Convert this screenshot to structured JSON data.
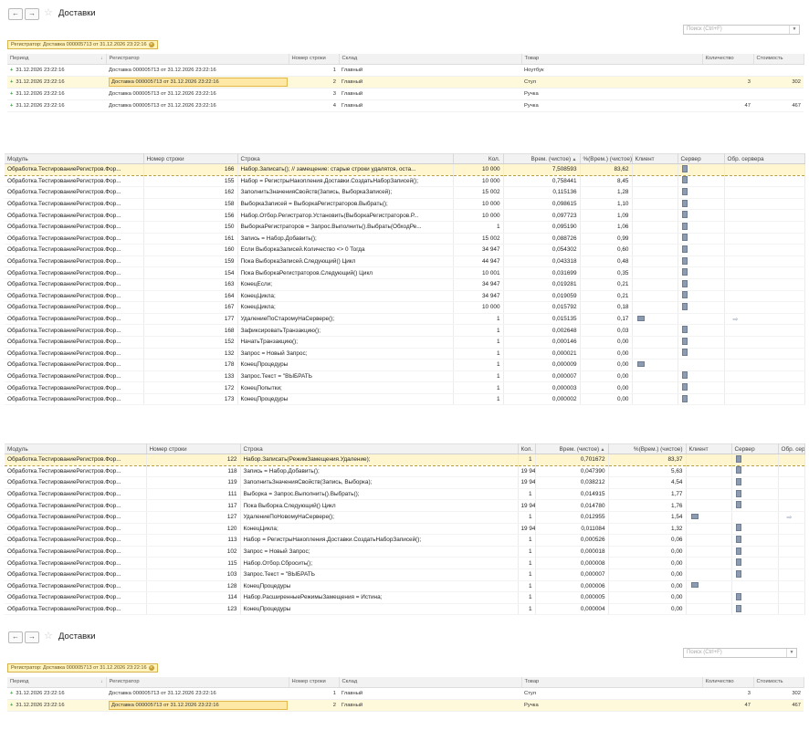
{
  "window1": {
    "title": "Доставки",
    "search_placeholder": "Поиск (Ctrl+F)",
    "registrar_badge": "Регистратор: Доставка 000005713 от 31.12.2026 23:22:16",
    "columns": [
      "Период",
      "Регистратор",
      "Номер строки",
      "Склад",
      "Товар",
      "Количество",
      "Стоимость"
    ],
    "rows": [
      {
        "period": "31.12.2026 23:22:16",
        "registrar": "Доставка 000005713 от 31.12.2026 23:22:16",
        "line": "1",
        "warehouse": "Главный",
        "product": "Ноутбук",
        "qty": "",
        "cost": ""
      },
      {
        "period": "31.12.2026 23:22:16",
        "registrar": "Доставка 000005713 от 31.12.2026 23:22:16",
        "line": "2",
        "warehouse": "Главный",
        "product": "Стул",
        "qty": "3",
        "cost": "302"
      },
      {
        "period": "31.12.2026 23:22:16",
        "registrar": "Доставка 000005713 от 31.12.2026 23:22:16",
        "line": "3",
        "warehouse": "Главный",
        "product": "Ручка",
        "qty": "",
        "cost": ""
      },
      {
        "period": "31.12.2026 23:22:16",
        "registrar": "Доставка 000005713 от 31.12.2026 23:22:16",
        "line": "4",
        "warehouse": "Главный",
        "product": "Ручка",
        "qty": "47",
        "cost": "467"
      }
    ]
  },
  "perf1": {
    "columns": [
      "Модуль",
      "Номер строки",
      "Строка",
      "Кол.",
      "Врем. (чистое)",
      "%(Врем.) (чистое)",
      "Клиент",
      "Сервер",
      "Обр. сервера"
    ],
    "rows": [
      {
        "module": "Обработка.ТестированиеРегистров.Фор...",
        "line": "166",
        "code": "Набор.Записать(); // замещение: старые строки удалятся, оста...",
        "count": "10 000",
        "time": "7,508593",
        "pct": "83,62",
        "client": false,
        "server": true,
        "srv_call": false
      },
      {
        "module": "Обработка.ТестированиеРегистров.Фор...",
        "line": "155",
        "code": "Набор = РегистрыНакопления.Доставки.СоздатьНаборЗаписей();",
        "count": "10 000",
        "time": "0,758441",
        "pct": "8,45",
        "client": false,
        "server": true,
        "srv_call": false
      },
      {
        "module": "Обработка.ТестированиеРегистров.Фор...",
        "line": "162",
        "code": "ЗаполнитьЗначенияСвойств(Запись, ВыборкаЗаписей);",
        "count": "15 002",
        "time": "0,115136",
        "pct": "1,28",
        "client": false,
        "server": true,
        "srv_call": false
      },
      {
        "module": "Обработка.ТестированиеРегистров.Фор...",
        "line": "158",
        "code": "ВыборкаЗаписей = ВыборкаРегистраторов.Выбрать();",
        "count": "10 000",
        "time": "0,098615",
        "pct": "1,10",
        "client": false,
        "server": true,
        "srv_call": false
      },
      {
        "module": "Обработка.ТестированиеРегистров.Фор...",
        "line": "156",
        "code": "Набор.Отбор.Регистратор.Установить(ВыборкаРегистраторов.Р...",
        "count": "10 000",
        "time": "0,097723",
        "pct": "1,09",
        "client": false,
        "server": true,
        "srv_call": false
      },
      {
        "module": "Обработка.ТестированиеРегистров.Фор...",
        "line": "150",
        "code": "ВыборкаРегистраторов = Запрос.Выполнить().Выбрать(ОбходРе...",
        "count": "1",
        "time": "0,095190",
        "pct": "1,06",
        "client": false,
        "server": true,
        "srv_call": false
      },
      {
        "module": "Обработка.ТестированиеРегистров.Фор...",
        "line": "161",
        "code": "Запись = Набор.Добавить();",
        "count": "15 002",
        "time": "0,088726",
        "pct": "0,99",
        "client": false,
        "server": true,
        "srv_call": false
      },
      {
        "module": "Обработка.ТестированиеРегистров.Фор...",
        "line": "160",
        "code": "Если ВыборкаЗаписей.Количество <> 0 Тогда",
        "count": "34 947",
        "time": "0,054302",
        "pct": "0,60",
        "client": false,
        "server": true,
        "srv_call": false
      },
      {
        "module": "Обработка.ТестированиеРегистров.Фор...",
        "line": "159",
        "code": "Пока ВыборкаЗаписей.Следующий() Цикл",
        "count": "44 947",
        "time": "0,043318",
        "pct": "0,48",
        "client": false,
        "server": true,
        "srv_call": false
      },
      {
        "module": "Обработка.ТестированиеРегистров.Фор...",
        "line": "154",
        "code": "Пока ВыборкаРегистраторов.Следующий() Цикл",
        "count": "10 001",
        "time": "0,031699",
        "pct": "0,35",
        "client": false,
        "server": true,
        "srv_call": false
      },
      {
        "module": "Обработка.ТестированиеРегистров.Фор...",
        "line": "163",
        "code": "КонецЕсли;",
        "count": "34 947",
        "time": "0,019281",
        "pct": "0,21",
        "client": false,
        "server": true,
        "srv_call": false
      },
      {
        "module": "Обработка.ТестированиеРегистров.Фор...",
        "line": "164",
        "code": "КонецЦикла;",
        "count": "34 947",
        "time": "0,019059",
        "pct": "0,21",
        "client": false,
        "server": true,
        "srv_call": false
      },
      {
        "module": "Обработка.ТестированиеРегистров.Фор...",
        "line": "167",
        "code": "КонецЦикла;",
        "count": "10 000",
        "time": "0,015792",
        "pct": "0,18",
        "client": false,
        "server": true,
        "srv_call": false
      },
      {
        "module": "Обработка.ТестированиеРегистров.Фор...",
        "line": "177",
        "code": "УдалениеПоСтаромуНаСервере();",
        "count": "1",
        "time": "0,015135",
        "pct": "0,17",
        "client": true,
        "server": false,
        "srv_call": true
      },
      {
        "module": "Обработка.ТестированиеРегистров.Фор...",
        "line": "168",
        "code": "ЗафиксироватьТранзакцию();",
        "count": "1",
        "time": "0,002648",
        "pct": "0,03",
        "client": false,
        "server": true,
        "srv_call": false
      },
      {
        "module": "Обработка.ТестированиеРегистров.Фор...",
        "line": "152",
        "code": "НачатьТранзакцию();",
        "count": "1",
        "time": "0,000146",
        "pct": "0,00",
        "client": false,
        "server": true,
        "srv_call": false
      },
      {
        "module": "Обработка.ТестированиеРегистров.Фор...",
        "line": "132",
        "code": "Запрос = Новый Запрос;",
        "count": "1",
        "time": "0,000021",
        "pct": "0,00",
        "client": false,
        "server": true,
        "srv_call": false
      },
      {
        "module": "Обработка.ТестированиеРегистров.Фор...",
        "line": "178",
        "code": "КонецПроцедуры",
        "count": "1",
        "time": "0,000009",
        "pct": "0,00",
        "client": true,
        "server": false,
        "srv_call": false
      },
      {
        "module": "Обработка.ТестированиеРегистров.Фор...",
        "line": "133",
        "code": "Запрос.Текст = \"ВЫБРАТЬ",
        "count": "1",
        "time": "0,000007",
        "pct": "0,00",
        "client": false,
        "server": true,
        "srv_call": false
      },
      {
        "module": "Обработка.ТестированиеРегистров.Фор...",
        "line": "172",
        "code": "КонецПопытки;",
        "count": "1",
        "time": "0,000003",
        "pct": "0,00",
        "client": false,
        "server": true,
        "srv_call": false
      },
      {
        "module": "Обработка.ТестированиеРегистров.Фор...",
        "line": "173",
        "code": "КонецПроцедуры",
        "count": "1",
        "time": "0,000002",
        "pct": "0,00",
        "client": false,
        "server": true,
        "srv_call": false
      }
    ]
  },
  "perf2": {
    "columns": [
      "Модуль",
      "Номер строки",
      "Строка",
      "Кол.",
      "Врем. (чистое)",
      "%(Врем.) (чистое)",
      "Клиент",
      "Сервер",
      "Обр. сервера"
    ],
    "rows": [
      {
        "module": "Обработка.ТестированиеРегистров.Фор...",
        "line": "122",
        "code": "Набор.Записать(РежимЗамещения.Удаление);",
        "count": "1",
        "time": "0,701672",
        "pct": "83,37",
        "client": false,
        "server": true,
        "srv_call": false
      },
      {
        "module": "Обработка.ТестированиеРегистров.Фор...",
        "line": "118",
        "code": "Запись = Набор.Добавить();",
        "count": "19 945",
        "time": "0,047390",
        "pct": "5,63",
        "client": false,
        "server": true,
        "srv_call": false
      },
      {
        "module": "Обработка.ТестированиеРегистров.Фор...",
        "line": "119",
        "code": "ЗаполнитьЗначенияСвойств(Запись, Выборка);",
        "count": "19 945",
        "time": "0,038212",
        "pct": "4,54",
        "client": false,
        "server": true,
        "srv_call": false
      },
      {
        "module": "Обработка.ТестированиеРегистров.Фор...",
        "line": "111",
        "code": "Выборка = Запрос.Выполнить().Выбрать();",
        "count": "1",
        "time": "0,014915",
        "pct": "1,77",
        "client": false,
        "server": true,
        "srv_call": false
      },
      {
        "module": "Обработка.ТестированиеРегистров.Фор...",
        "line": "117",
        "code": "Пока Выборка.Следующий() Цикл",
        "count": "19 946",
        "time": "0,014780",
        "pct": "1,76",
        "client": false,
        "server": true,
        "srv_call": false
      },
      {
        "module": "Обработка.ТестированиеРегистров.Фор...",
        "line": "127",
        "code": "УдалениеПоНовомуНаСервере();",
        "count": "1",
        "time": "0,012955",
        "pct": "1,54",
        "client": true,
        "server": false,
        "srv_call": true
      },
      {
        "module": "Обработка.ТестированиеРегистров.Фор...",
        "line": "120",
        "code": "КонецЦикла;",
        "count": "19 945",
        "time": "0,011084",
        "pct": "1,32",
        "client": false,
        "server": true,
        "srv_call": false
      },
      {
        "module": "Обработка.ТестированиеРегистров.Фор...",
        "line": "113",
        "code": "Набор = РегистрыНакопления.Доставки.СоздатьНаборЗаписей();",
        "count": "1",
        "time": "0,000526",
        "pct": "0,06",
        "client": false,
        "server": true,
        "srv_call": false
      },
      {
        "module": "Обработка.ТестированиеРегистров.Фор...",
        "line": "102",
        "code": "Запрос = Новый Запрос;",
        "count": "1",
        "time": "0,000018",
        "pct": "0,00",
        "client": false,
        "server": true,
        "srv_call": false
      },
      {
        "module": "Обработка.ТестированиеРегистров.Фор...",
        "line": "115",
        "code": "Набор.Отбор.Сбросить();",
        "count": "1",
        "time": "0,000008",
        "pct": "0,00",
        "client": false,
        "server": true,
        "srv_call": false
      },
      {
        "module": "Обработка.ТестированиеРегистров.Фор...",
        "line": "103",
        "code": "Запрос.Текст = \"ВЫБРАТЬ",
        "count": "1",
        "time": "0,000007",
        "pct": "0,00",
        "client": false,
        "server": true,
        "srv_call": false
      },
      {
        "module": "Обработка.ТестированиеРегистров.Фор...",
        "line": "128",
        "code": "КонецПроцедуры",
        "count": "1",
        "time": "0,000006",
        "pct": "0,00",
        "client": true,
        "server": false,
        "srv_call": false
      },
      {
        "module": "Обработка.ТестированиеРегистров.Фор...",
        "line": "114",
        "code": "Набор.РасширенныеРежимыЗамещения = Истина;",
        "count": "1",
        "time": "0,000005",
        "pct": "0,00",
        "client": false,
        "server": true,
        "srv_call": false
      },
      {
        "module": "Обработка.ТестированиеРегистров.Фор...",
        "line": "123",
        "code": "КонецПроцедуры",
        "count": "1",
        "time": "0,000004",
        "pct": "0,00",
        "client": false,
        "server": true,
        "srv_call": false
      }
    ]
  },
  "window2": {
    "title": "Доставки",
    "search_placeholder": "Поиск (Ctrl+F)",
    "registrar_badge": "Регистратор: Доставка 000005713 от 31.12.2026 23:22:16",
    "columns": [
      "Период",
      "Регистратор",
      "Номер строки",
      "Склад",
      "Товар",
      "Количество",
      "Стоимость"
    ],
    "rows": [
      {
        "period": "31.12.2026 23:22:16",
        "registrar": "Доставка 000005713 от 31.12.2026 23:22:16",
        "line": "1",
        "warehouse": "Главный",
        "product": "Стул",
        "qty": "3",
        "cost": "302"
      },
      {
        "period": "31.12.2026 23:22:16",
        "registrar": "Доставка 000005713 от 31.12.2026 23:22:16",
        "line": "2",
        "warehouse": "Главный",
        "product": "Ручка",
        "qty": "47",
        "cost": "467"
      }
    ]
  }
}
